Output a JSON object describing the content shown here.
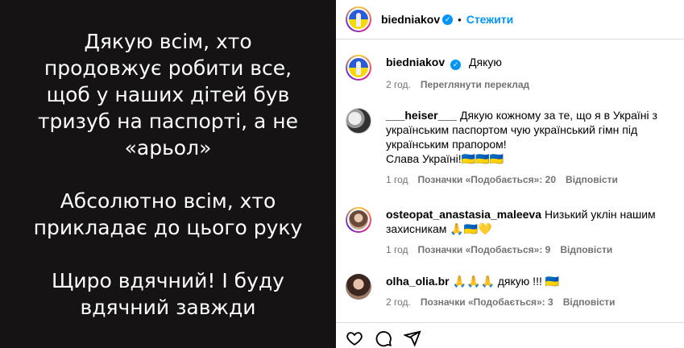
{
  "post": {
    "paragraphs": [
      "Дякую всім, хто\nпродовжує робити все,\nщоб у наших дітей був\nтризуб на паспорті, а не\n«арьол»",
      "Абсолютно всім, хто\nприкладає до цього руку",
      "Щиро вдячний! І буду\nвдячний завжди"
    ]
  },
  "header": {
    "username": "biedniakov",
    "verified_icon": "verified-badge-icon",
    "separator": "•",
    "follow_label": "Стежити"
  },
  "caption": {
    "username": "biedniakov",
    "text": "Дякую",
    "time": "2 год.",
    "translate_label": "Переглянути переклад"
  },
  "comments": [
    {
      "username": "___heiser___",
      "text": "Дякую кожному за те, що я в Україні з\nукраїнським паспортом чую український гімн під\nукраїнським прапором!\nСлава Україні!🇺🇦🇺🇦🇺🇦",
      "time": "1 год",
      "likes": "Позначки «Подобається»: 20",
      "reply": "Відповісти"
    },
    {
      "username": "osteopat_anastasia_maleeva",
      "text": "Низький уклін нашим\nзахисникам 🙏🇺🇦💛",
      "time": "1 год",
      "likes": "Позначки «Подобається»: 9",
      "reply": "Відповісти"
    },
    {
      "username": "olha_olia.br",
      "text": "🙏🙏🙏 дякую !!! 🇺🇦",
      "time": "2 год.",
      "likes": "Позначки «Подобається»: 3",
      "reply": "Відповісти"
    }
  ],
  "actions": [
    "heart-icon",
    "comment-icon",
    "share-icon"
  ]
}
